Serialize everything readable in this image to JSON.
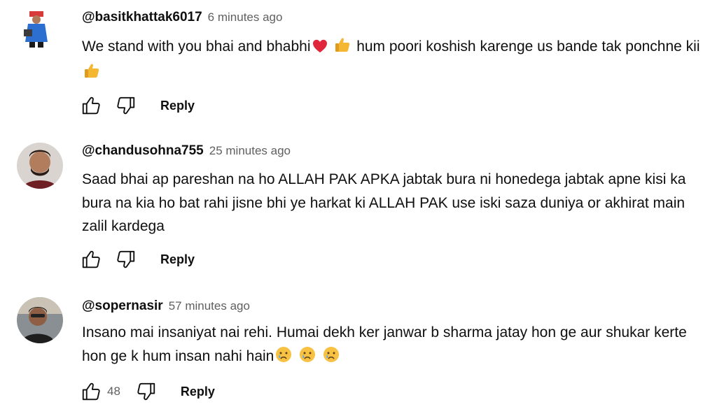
{
  "comments": [
    {
      "author": "@basitkhattak6017",
      "time": "6 minutes ago",
      "text_parts": [
        "We stand with you bhai and bhabhi",
        " hum poori koshish karenge us bande tak ponchne kii"
      ],
      "like_count": "",
      "reply_label": "Reply"
    },
    {
      "author": "@chandusohna755",
      "time": "25 minutes ago",
      "text_parts": [
        "Saad bhai ap pareshan na ho ALLAH PAK APKA jabtak bura ni honedega jabtak apne kisi ka bura na kia ho bat rahi jisne bhi ye harkat ki ALLAH PAK use iski saza duniya or akhirat main zalil kardega"
      ],
      "like_count": "",
      "reply_label": "Reply"
    },
    {
      "author": "@sopernasir",
      "time": "57 minutes ago",
      "text_parts": [
        "Insano mai insaniyat nai rehi. Humai dekh ker janwar b sharma jatay hon ge aur shukar kerte hon ge k hum insan nahi hain"
      ],
      "like_count": "48",
      "reply_label": "Reply"
    }
  ],
  "icons": {
    "like": "thumbs-up-outline-icon",
    "dislike": "thumbs-down-outline-icon",
    "emoji_heart": "red-heart-emoji",
    "emoji_thumbs": "thumbs-up-emoji",
    "emoji_cry": "crying-face-emoji"
  },
  "colors": {
    "text": "#0f0f0f",
    "secondary": "#606060",
    "heart": "#e0263a",
    "thumb_emoji": "#f5b631",
    "cry_emoji": "#f7c244"
  }
}
